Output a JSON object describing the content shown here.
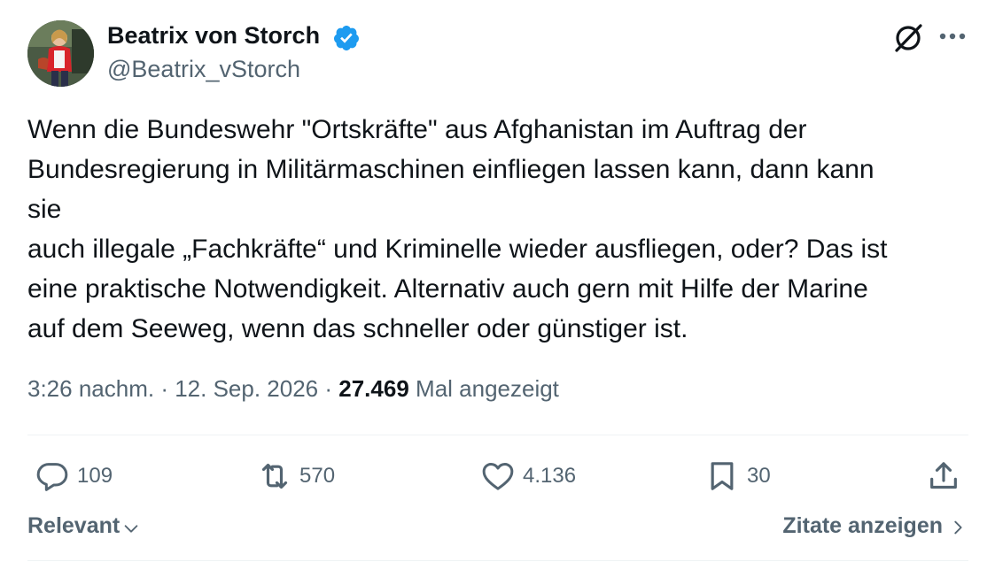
{
  "author": {
    "name": "Beatrix von Storch",
    "handle": "@Beatrix_vStorch",
    "verified": true,
    "verified_color": "#1d9bf0"
  },
  "tweet": {
    "lines": [
      "Wenn die Bundeswehr \"Ortskräfte\" aus Afghanistan im Auftrag der",
      "Bundesregierung in Militärmaschinen einfliegen lassen kann, dann kann",
      "sie",
      "auch illegale „Fachkräfte“ und Kriminelle wieder ausfliegen, oder? Das ist",
      "eine praktische Notwendigkeit. Alternativ auch gern mit Hilfe der Marine",
      "auf dem Seeweg, wenn das schneller oder günstiger ist."
    ],
    "time": "3:26 nachm.",
    "date": "12. Sep. 2026",
    "views": "27.469",
    "views_label": "Mal angezeigt"
  },
  "actions": {
    "replies": "109",
    "reposts": "570",
    "likes": "4.136",
    "bookmarks": "30"
  },
  "icons": {
    "reply": "reply-icon",
    "repost": "repost-icon",
    "like": "heart-icon",
    "bookmark": "bookmark-icon",
    "share": "share-icon",
    "grok": "grok-icon",
    "more": "more-icon"
  },
  "footer": {
    "sort_label": "Relevant",
    "quotes_label": "Zitate anzeigen"
  },
  "colors": {
    "text": "#0f1419",
    "secondary": "#536471",
    "divider": "#eff3f4"
  }
}
